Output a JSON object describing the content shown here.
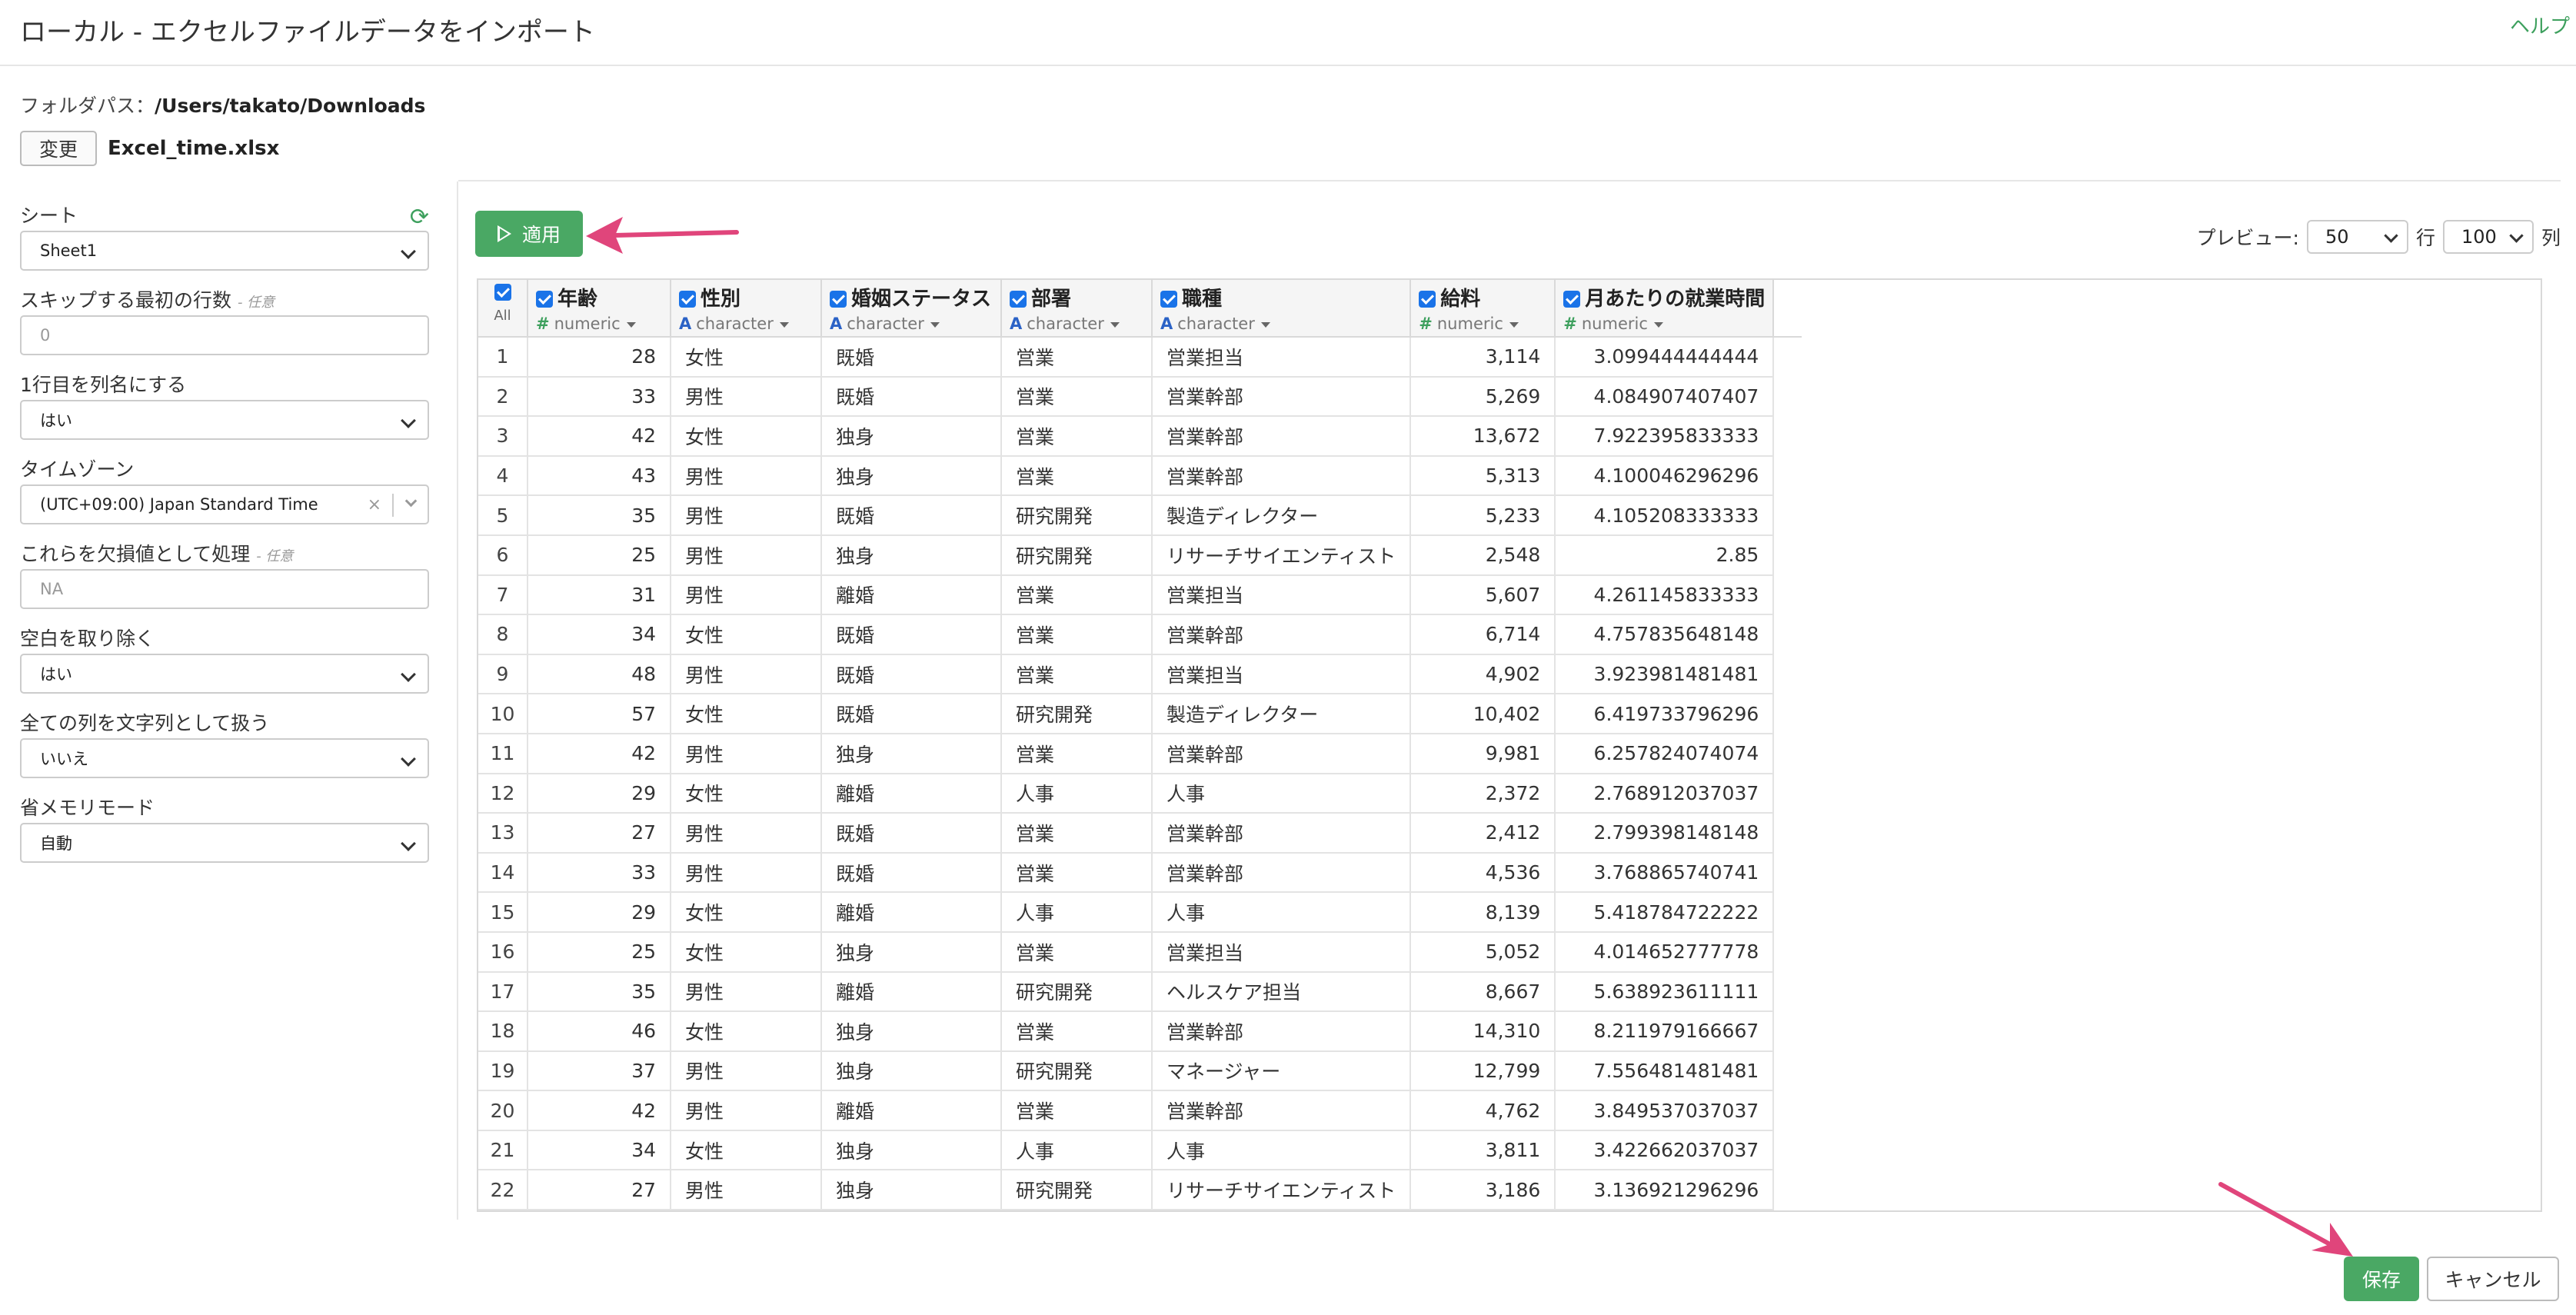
{
  "header": {
    "title": "ローカル - エクセルファイルデータをインポート",
    "help": "ヘルプ"
  },
  "file": {
    "folder_label": "フォルダパス：",
    "folder_path": "/Users/takato/Downloads",
    "change_button": "変更",
    "file_name": "Excel_time.xlsx"
  },
  "sidebar": {
    "sheet_label": "シート",
    "sheet_value": "Sheet1",
    "skip_label": "スキップする最初の行数",
    "skip_optional": "- 任意",
    "skip_value": "0",
    "header_row_label": "1行目を列名にする",
    "header_row_value": "はい",
    "timezone_label": "タイムゾーン",
    "timezone_value": "(UTC+09:00) Japan Standard Time",
    "na_label": "これらを欠損値として処理",
    "na_optional": "- 任意",
    "na_placeholder": "NA",
    "trim_label": "空白を取り除く",
    "trim_value": "はい",
    "as_text_label": "全ての列を文字列として扱う",
    "as_text_value": "いいえ",
    "memory_label": "省メモリモード",
    "memory_value": "自動"
  },
  "toolbar": {
    "apply_label": "適用",
    "preview_label": "プレビュー:",
    "rows_value": "50",
    "rows_unit": "行",
    "cols_value": "100",
    "cols_unit": "列"
  },
  "table": {
    "all_label": "All",
    "columns": [
      {
        "name": "年齢",
        "type": "numeric",
        "type_icon": "#"
      },
      {
        "name": "性別",
        "type": "character",
        "type_icon": "A"
      },
      {
        "name": "婚姻ステータス",
        "type": "character",
        "type_icon": "A"
      },
      {
        "name": "部署",
        "type": "character",
        "type_icon": "A"
      },
      {
        "name": "職種",
        "type": "character",
        "type_icon": "A"
      },
      {
        "name": "給料",
        "type": "numeric",
        "type_icon": "#"
      },
      {
        "name": "月あたりの就業時間",
        "type": "numeric",
        "type_icon": "#"
      }
    ],
    "rows": [
      [
        "1",
        "28",
        "女性",
        "既婚",
        "営業",
        "営業担当",
        "3,114",
        "3.099444444444"
      ],
      [
        "2",
        "33",
        "男性",
        "既婚",
        "営業",
        "営業幹部",
        "5,269",
        "4.084907407407"
      ],
      [
        "3",
        "42",
        "女性",
        "独身",
        "営業",
        "営業幹部",
        "13,672",
        "7.922395833333"
      ],
      [
        "4",
        "43",
        "男性",
        "独身",
        "営業",
        "営業幹部",
        "5,313",
        "4.100046296296"
      ],
      [
        "5",
        "35",
        "男性",
        "既婚",
        "研究開発",
        "製造ディレクター",
        "5,233",
        "4.105208333333"
      ],
      [
        "6",
        "25",
        "男性",
        "独身",
        "研究開発",
        "リサーチサイエンティスト",
        "2,548",
        "2.85"
      ],
      [
        "7",
        "31",
        "男性",
        "離婚",
        "営業",
        "営業担当",
        "5,607",
        "4.261145833333"
      ],
      [
        "8",
        "34",
        "女性",
        "既婚",
        "営業",
        "営業幹部",
        "6,714",
        "4.757835648148"
      ],
      [
        "9",
        "48",
        "男性",
        "既婚",
        "営業",
        "営業担当",
        "4,902",
        "3.923981481481"
      ],
      [
        "10",
        "57",
        "女性",
        "既婚",
        "研究開発",
        "製造ディレクター",
        "10,402",
        "6.419733796296"
      ],
      [
        "11",
        "42",
        "男性",
        "独身",
        "営業",
        "営業幹部",
        "9,981",
        "6.257824074074"
      ],
      [
        "12",
        "29",
        "女性",
        "離婚",
        "人事",
        "人事",
        "2,372",
        "2.768912037037"
      ],
      [
        "13",
        "27",
        "男性",
        "既婚",
        "営業",
        "営業幹部",
        "2,412",
        "2.799398148148"
      ],
      [
        "14",
        "33",
        "男性",
        "既婚",
        "営業",
        "営業幹部",
        "4,536",
        "3.768865740741"
      ],
      [
        "15",
        "29",
        "女性",
        "離婚",
        "人事",
        "人事",
        "8,139",
        "5.418784722222"
      ],
      [
        "16",
        "25",
        "女性",
        "独身",
        "営業",
        "営業担当",
        "5,052",
        "4.014652777778"
      ],
      [
        "17",
        "35",
        "男性",
        "離婚",
        "研究開発",
        "ヘルスケア担当",
        "8,667",
        "5.638923611111"
      ],
      [
        "18",
        "46",
        "女性",
        "独身",
        "営業",
        "営業幹部",
        "14,310",
        "8.211979166667"
      ],
      [
        "19",
        "37",
        "男性",
        "独身",
        "研究開発",
        "マネージャー",
        "12,799",
        "7.556481481481"
      ],
      [
        "20",
        "42",
        "男性",
        "離婚",
        "営業",
        "営業幹部",
        "4,762",
        "3.849537037037"
      ],
      [
        "21",
        "34",
        "女性",
        "独身",
        "人事",
        "人事",
        "3,811",
        "3.422662037037"
      ],
      [
        "22",
        "27",
        "男性",
        "独身",
        "研究開発",
        "リサーチサイエンティスト",
        "3,186",
        "3.136921296296"
      ]
    ]
  },
  "footer": {
    "save_label": "保存",
    "cancel_label": "キャンセル"
  },
  "colors": {
    "accent_green": "#4aa864",
    "checkbox_blue": "#1a73e8",
    "annotation_arrow": "#e0457b"
  }
}
